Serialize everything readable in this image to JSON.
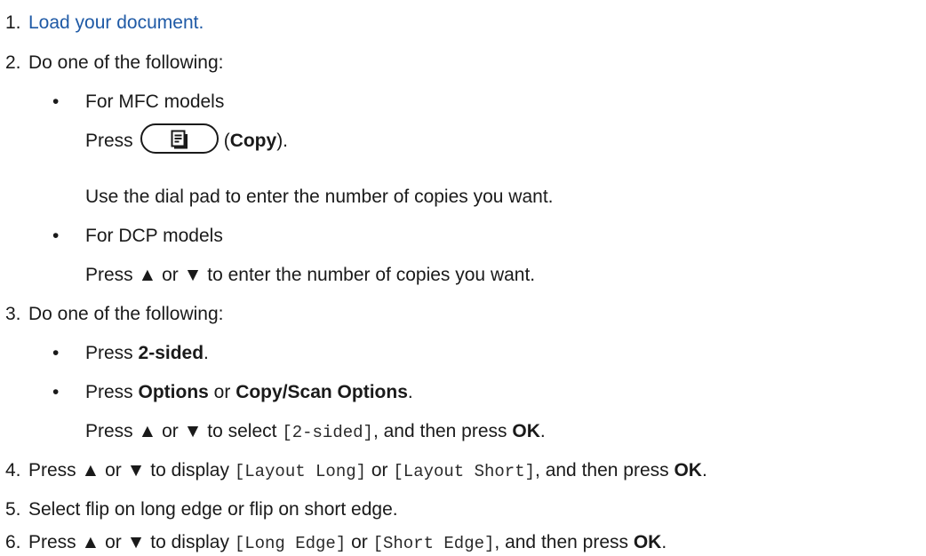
{
  "steps": [
    {
      "num": "1.",
      "link": "Load your document."
    },
    {
      "num": "2.",
      "text": "Do one of the following:"
    },
    {
      "num": "3.",
      "text": "Do one of the following:"
    },
    {
      "num": "4.",
      "pre": "Press ▲ or ▼ to display ",
      "code1": "[Layout Long]",
      "mid": " or ",
      "code2": "[Layout Short]",
      "post": ", and then press ",
      "bold": "OK",
      "end": "."
    },
    {
      "num": "5.",
      "text": "Select flip on long edge or flip on short edge."
    },
    {
      "num": "6.",
      "pre": "Press ▲ or ▼ to display ",
      "code1": "[Long Edge]",
      "mid": " or ",
      "code2": "[Short Edge]",
      "post": ", and then press ",
      "bold": "OK",
      "end": "."
    }
  ],
  "step2": {
    "mfc": {
      "bullet": "•",
      "title": "For MFC models",
      "press": "Press",
      "copy_open": "(",
      "copy_bold": "Copy",
      "copy_close": ").",
      "icon": "copy-icon",
      "dialpad": "Use the dial pad to enter the number of copies you want."
    },
    "dcp": {
      "bullet": "•",
      "title": "For DCP models",
      "instr": "Press ▲ or ▼ to enter the number of copies you want."
    }
  },
  "step3": {
    "opt1": {
      "bullet": "•",
      "pre": "Press ",
      "bold": "2-sided",
      "end": "."
    },
    "opt2": {
      "bullet": "•",
      "pre": "Press ",
      "bold1": "Options",
      "mid": " or ",
      "bold2": "Copy/Scan Options",
      "end": "."
    },
    "opt2_sub": {
      "pre": "Press ▲ or ▼ to select ",
      "code": "[2-sided]",
      "post": ", and then press ",
      "bold": "OK",
      "end": "."
    }
  }
}
